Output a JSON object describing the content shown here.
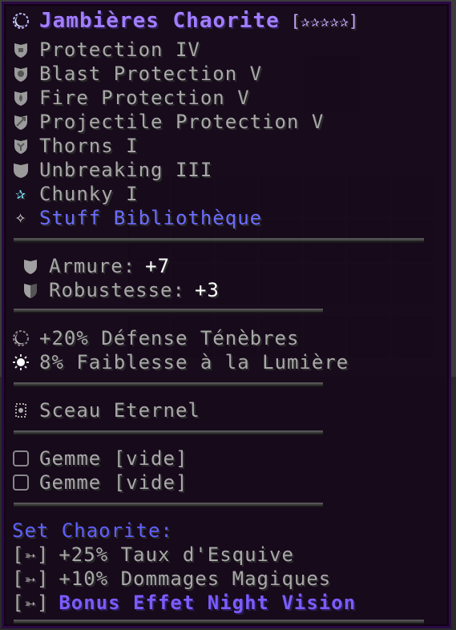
{
  "item": {
    "title": "Jambières Chaorite",
    "rarity_stars": "[✰✰✰✰✰]"
  },
  "enchantments": [
    {
      "label": "Protection IV",
      "icon": "shield-icon"
    },
    {
      "label": "Blast Protection V",
      "icon": "blast-shield-icon"
    },
    {
      "label": "Fire Protection V",
      "icon": "fire-shield-icon"
    },
    {
      "label": "Projectile Protection V",
      "icon": "arrow-shield-icon"
    },
    {
      "label": "Thorns I",
      "icon": "thorns-shield-icon"
    },
    {
      "label": "Unbreaking III",
      "icon": "unbreaking-shield-icon"
    }
  ],
  "special_enchant": {
    "label": "Chunky I",
    "icon": "star-icon",
    "color": "#7fe9ff"
  },
  "library": {
    "label": "Stuff Bibliothèque",
    "icon": "sparkle-icon",
    "color": "#6c6cff"
  },
  "stats": [
    {
      "name": "Armure:",
      "value": "+7",
      "icon": "armor-icon"
    },
    {
      "name": "Robustesse:",
      "value": "+3",
      "icon": "toughness-icon"
    }
  ],
  "effects": [
    {
      "label": "+20% Défense Ténèbres",
      "icon": "moon-icon"
    },
    {
      "label": "8% Faiblesse à la Lumière",
      "icon": "sun-icon"
    }
  ],
  "seal": {
    "label": "Sceau Eternel",
    "icon": "seal-icon"
  },
  "gems": [
    {
      "label": "Gemme [vide]",
      "icon": "empty-gem-slot-icon"
    },
    {
      "label": "Gemme [vide]",
      "icon": "empty-gem-slot-icon"
    }
  ],
  "set": {
    "name": "Set Chaorite:",
    "bonuses": [
      {
        "prefix": "[➳]",
        "text": "+25% Taux d'Esquive"
      },
      {
        "prefix": "[➳]",
        "text": "+10% Dommages Magiques"
      },
      {
        "prefix": "[➳]",
        "text": "Bonus Effet Night Vision"
      }
    ]
  },
  "colors": {
    "title": "#a27dff",
    "text": "#a8a8a8",
    "set_label": "#6060ff",
    "bonus": "#7b5cff",
    "tooltip_bg": "#16081a"
  }
}
